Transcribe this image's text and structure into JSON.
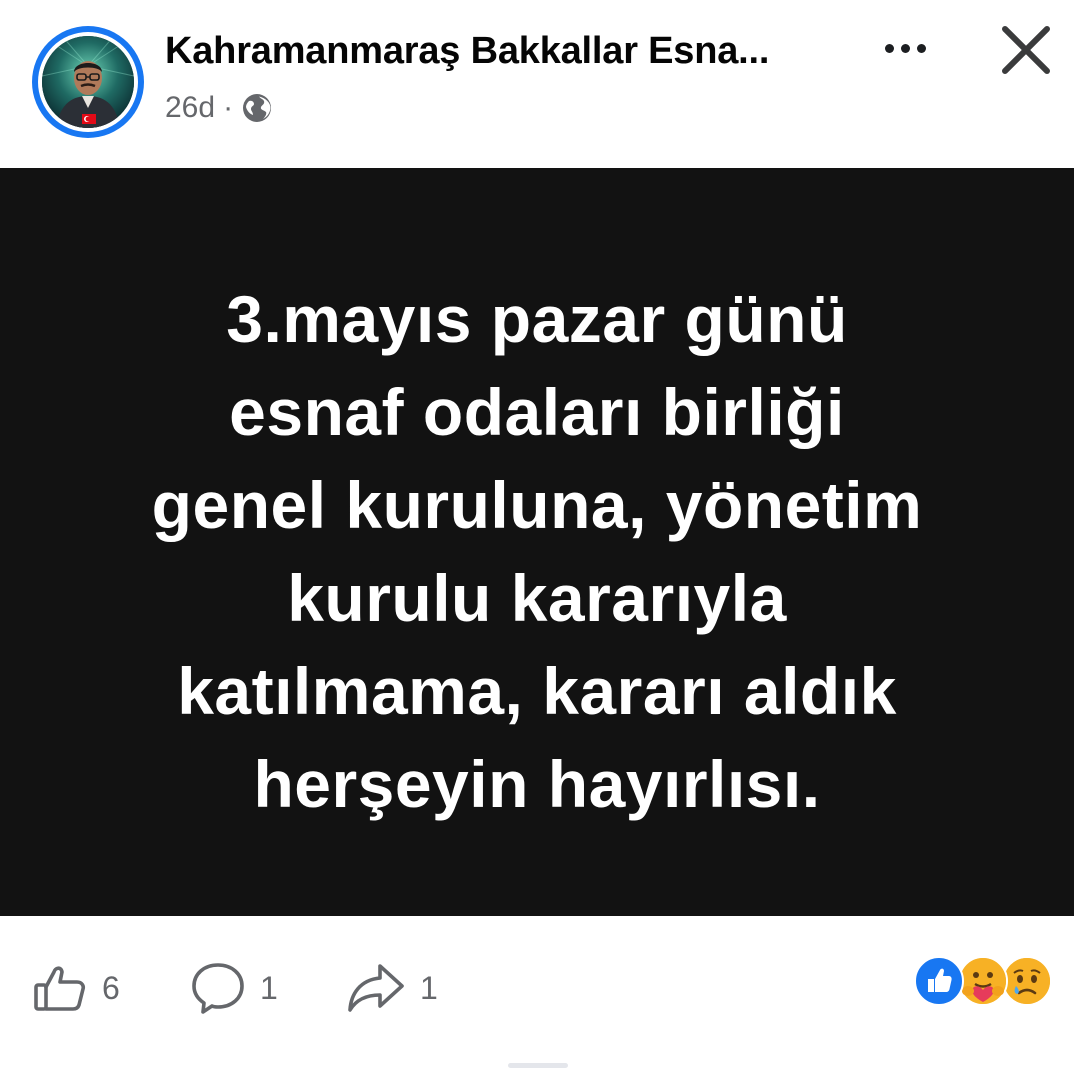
{
  "header": {
    "page_name": "Kahramanmaraş Bakkallar Esna...",
    "time_ago": "26d",
    "separator": "·",
    "privacy_icon": "globe-icon",
    "more_icon": "more-horizontal-icon",
    "close_icon": "close-icon"
  },
  "post": {
    "background_color": "#121212",
    "text_color": "#ffffff",
    "lines": [
      "3.mayıs pazar günü",
      "esnaf odaları birliği",
      "genel kuruluna, yönetim",
      "kurulu kararıyla",
      "katılmama, kararı aldık",
      "herşeyin hayırlısı."
    ]
  },
  "actions": {
    "like": {
      "icon": "like-icon",
      "count": "6"
    },
    "comment": {
      "icon": "comment-icon",
      "count": "1"
    },
    "share": {
      "icon": "share-icon",
      "count": "1"
    }
  },
  "reactions": {
    "items": [
      "like-reaction-icon",
      "care-reaction-icon",
      "sad-reaction-icon"
    ],
    "colors": {
      "like": "#1877f2",
      "care": "#f7b125",
      "sad": "#f7b125"
    }
  }
}
